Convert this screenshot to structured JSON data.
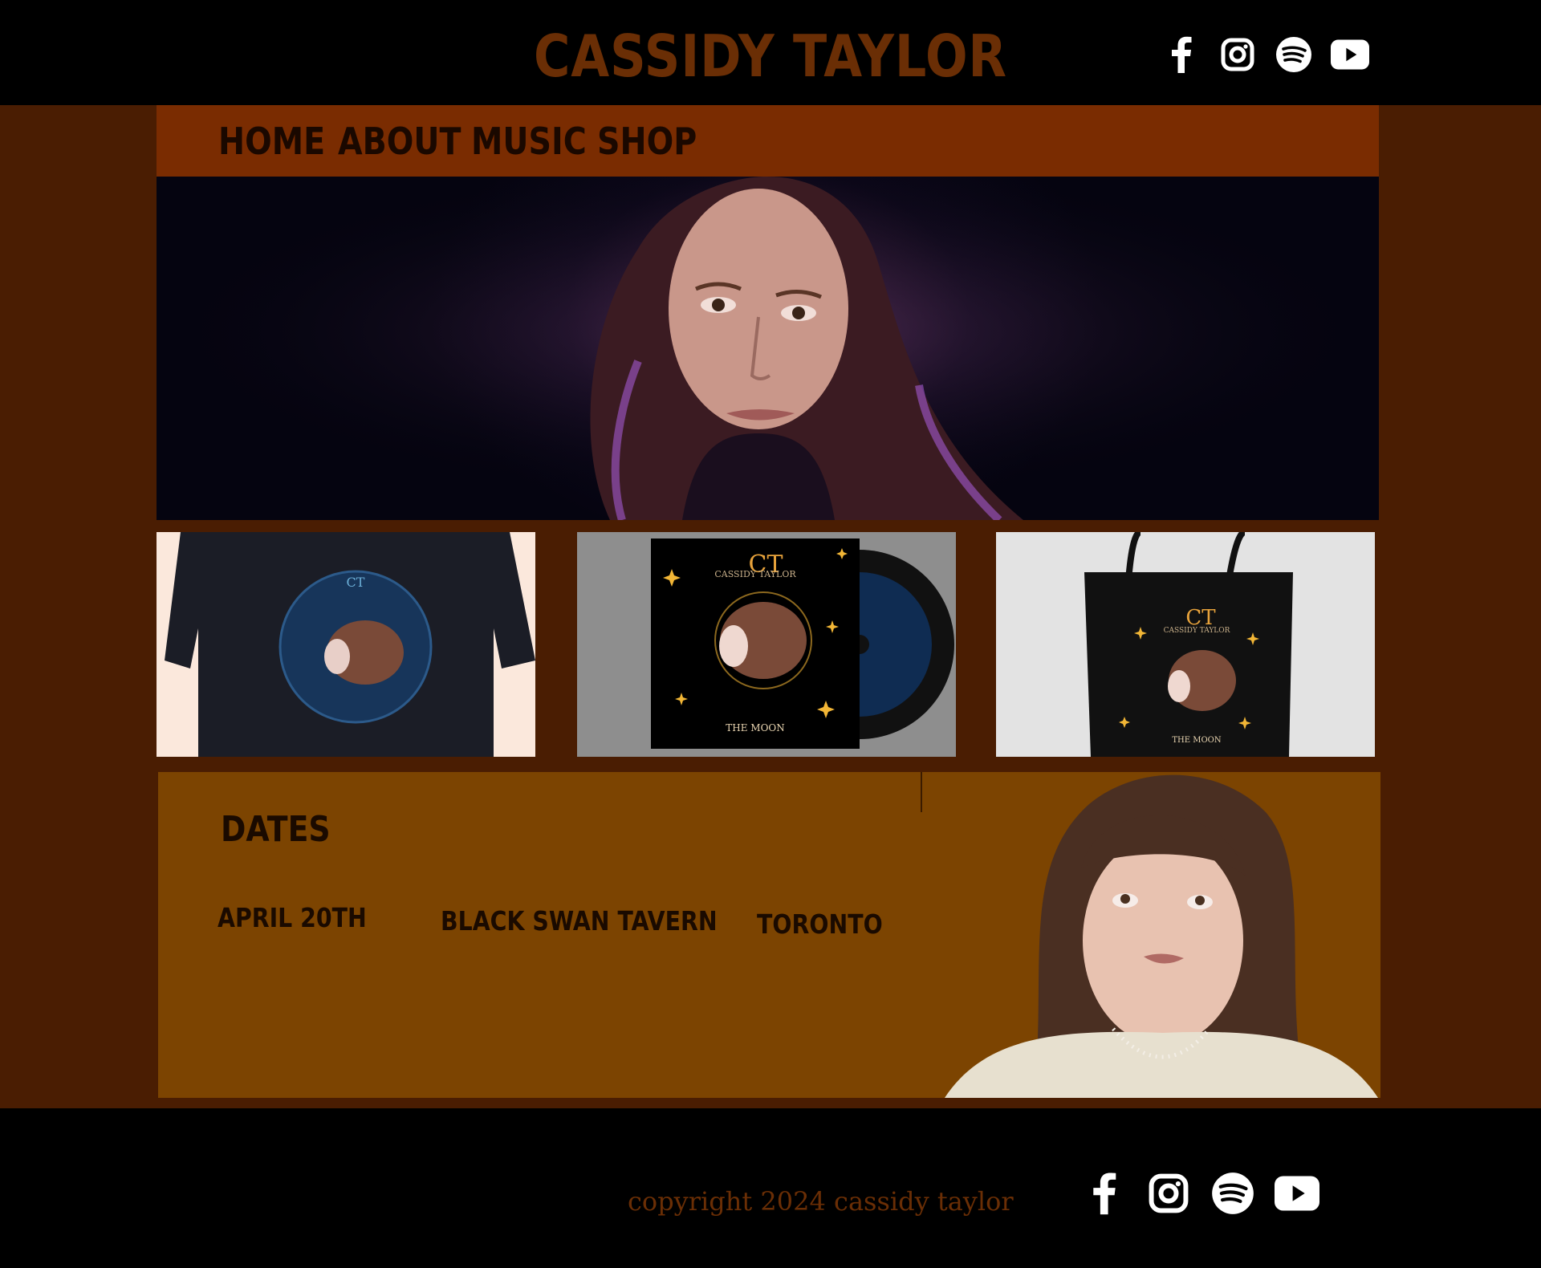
{
  "header": {
    "title": "CASSIDY TAYLOR"
  },
  "social": [
    "facebook-icon",
    "instagram-icon",
    "spotify-icon",
    "youtube-icon"
  ],
  "nav": {
    "items": [
      "HOME",
      "ABOUT",
      "MUSIC",
      "SHOP"
    ]
  },
  "products": {
    "album_brand_initials": "CT",
    "album_brand": "CASSIDY TAYLOR",
    "album_title": "THE MOON"
  },
  "dates": {
    "title": "DATES",
    "events": [
      {
        "date": "APRIL 20TH",
        "venue": "BLACK SWAN TAVERN",
        "city": "TORONTO"
      }
    ]
  },
  "footer": {
    "copyright": "copyright 2024 cassidy taylor"
  },
  "colors": {
    "accent": "#6a2e05",
    "nav_bg": "#7a2c01",
    "dates_bg": "#7c4401",
    "page_bg": "#4a1d02"
  }
}
